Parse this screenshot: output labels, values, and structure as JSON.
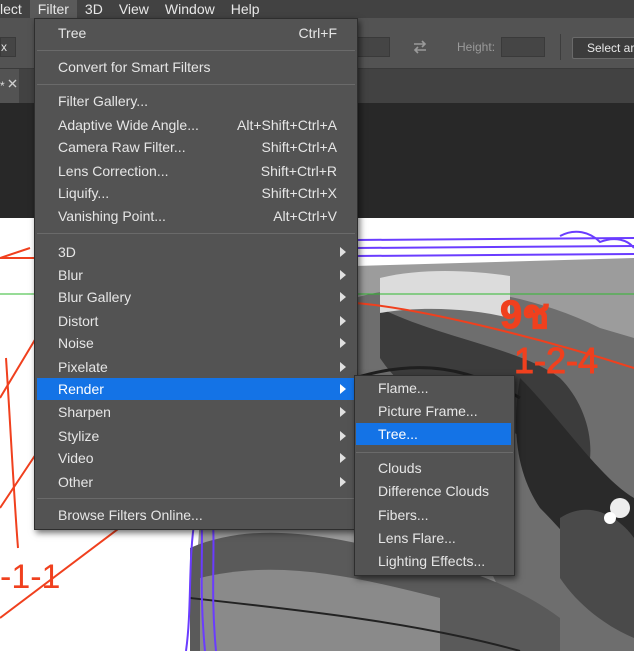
{
  "menubar": {
    "items": [
      "lect",
      "Filter",
      "3D",
      "View",
      "Window",
      "Help"
    ],
    "active": "Filter"
  },
  "options_bar": {
    "left_field_value": "x",
    "height_label": "Height:",
    "select_button_label": "Select ar"
  },
  "doc_tab": {
    "label": "*"
  },
  "filter_menu": {
    "items": [
      {
        "label": "Tree",
        "shortcut": "Ctrl+F"
      },
      {
        "label": "Convert for Smart Filters",
        "shortcut": ""
      },
      {
        "label": "Filter Gallery...",
        "shortcut": ""
      },
      {
        "label": "Adaptive Wide Angle...",
        "shortcut": "Alt+Shift+Ctrl+A"
      },
      {
        "label": "Camera Raw Filter...",
        "shortcut": "Shift+Ctrl+A"
      },
      {
        "label": "Lens Correction...",
        "shortcut": "Shift+Ctrl+R"
      },
      {
        "label": "Liquify...",
        "shortcut": "Shift+Ctrl+X"
      },
      {
        "label": "Vanishing Point...",
        "shortcut": "Alt+Ctrl+V"
      },
      {
        "label": "3D",
        "submenu": true
      },
      {
        "label": "Blur",
        "submenu": true
      },
      {
        "label": "Blur Gallery",
        "submenu": true
      },
      {
        "label": "Distort",
        "submenu": true
      },
      {
        "label": "Noise",
        "submenu": true
      },
      {
        "label": "Pixelate",
        "submenu": true
      },
      {
        "label": "Render",
        "submenu": true,
        "highlighted": true
      },
      {
        "label": "Sharpen",
        "submenu": true
      },
      {
        "label": "Stylize",
        "submenu": true
      },
      {
        "label": "Video",
        "submenu": true
      },
      {
        "label": "Other",
        "submenu": true
      },
      {
        "label": "Browse Filters Online...",
        "shortcut": ""
      }
    ]
  },
  "render_submenu": {
    "items": [
      {
        "label": "Flame..."
      },
      {
        "label": "Picture Frame..."
      },
      {
        "label": "Tree...",
        "highlighted": true
      },
      {
        "label": "Clouds"
      },
      {
        "label": "Difference Clouds"
      },
      {
        "label": "Fibers..."
      },
      {
        "label": "Lens Flare..."
      },
      {
        "label": "Lighting Effects..."
      }
    ]
  },
  "canvas": {
    "sketch_text_top": "9ช",
    "sketch_text_mid": "1-2-4",
    "sketch_text_left": "-1-1"
  },
  "colors": {
    "menu_bg": "#535353",
    "highlight": "#1473e6",
    "chrome_dark": "#424242",
    "sketch_red": "#f0401e",
    "sketch_purple": "#6a3cff",
    "guide_green": "#2fb82f"
  }
}
